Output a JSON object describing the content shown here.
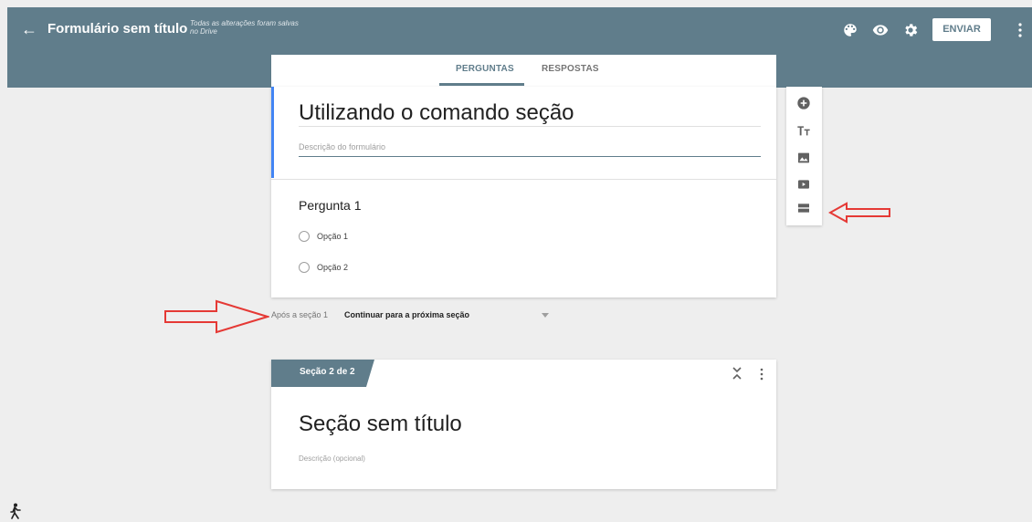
{
  "header": {
    "title": "Formulário sem título",
    "save_status": "Todas as alterações foram salvas no Drive",
    "send_label": "ENVIAR",
    "icons": [
      "palette-icon",
      "eye-icon",
      "gear-icon",
      "more-vert-icon"
    ],
    "color": "#607d8b"
  },
  "tabs": [
    {
      "label": "PERGUNTAS",
      "active": true
    },
    {
      "label": "RESPOSTAS",
      "active": false
    }
  ],
  "form": {
    "title": "Utilizando o comando seção",
    "description_placeholder": "Descrição do formulário",
    "question": {
      "title": "Pergunta 1",
      "options": [
        "Opção 1",
        "Opção 2"
      ]
    }
  },
  "section_nav": {
    "label": "Após a seção 1",
    "value": "Continuar para a próxima seção"
  },
  "section2": {
    "tab_label": "Seção 2 de 2",
    "title": "Seção sem título",
    "description_placeholder": "Descrição (opcional)"
  },
  "toolbar": {
    "icons": [
      "add-circle-icon",
      "text-format-icon",
      "image-icon",
      "video-icon",
      "section-icon"
    ]
  },
  "annotations": {
    "arrow_color": "#e53935"
  }
}
